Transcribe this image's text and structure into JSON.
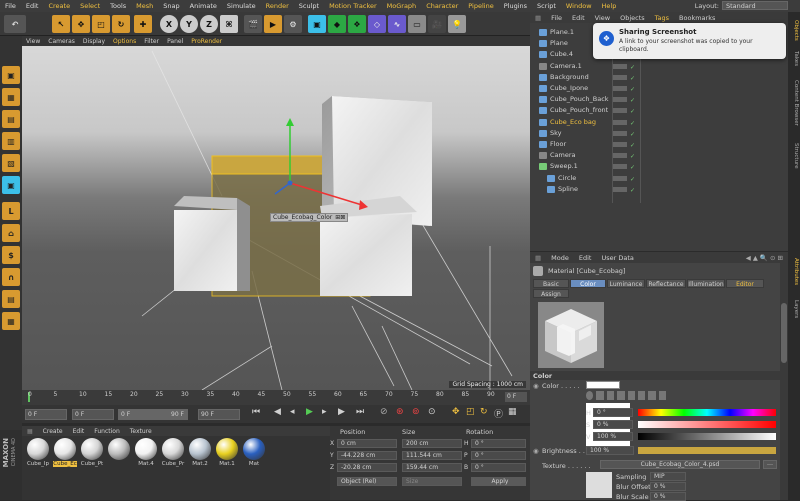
{
  "menubar": {
    "items": [
      "File",
      "Edit",
      "Create",
      "Select",
      "Tools",
      "Mesh",
      "Snap",
      "Animate",
      "Simulate",
      "Render",
      "Sculpt",
      "Motion Tracker",
      "MoGraph",
      "Character",
      "Pipeline",
      "Plugins",
      "Script",
      "Window",
      "Help"
    ],
    "highlighted": [
      "Create",
      "Select",
      "Mesh",
      "Render",
      "Motion Tracker",
      "MoGraph",
      "Character",
      "Pipeline",
      "Window",
      "Help"
    ],
    "layout_label": "Layout:",
    "layout_value": "Standard"
  },
  "toolbar": {
    "axis_x": "X",
    "axis_y": "Y",
    "axis_z": "Z"
  },
  "viewport": {
    "menu": [
      "View",
      "Cameras",
      "Display",
      "Options",
      "Filter",
      "Panel",
      "ProRender"
    ],
    "menu_highlight": [
      "Options",
      "ProRender"
    ],
    "perspective_label": "",
    "selected_object_label": "Cube_Ecobag_Color",
    "grid_spacing": "Grid Spacing : 1000 cm"
  },
  "timeline": {
    "ticks": [
      "0",
      "5",
      "10",
      "15",
      "20",
      "25",
      "30",
      "35",
      "40",
      "45",
      "50",
      "55",
      "60",
      "65",
      "70",
      "75",
      "80",
      "85",
      "90"
    ],
    "end_frame": "0 F",
    "current": "0 F",
    "start": "0 F",
    "min": "0 F",
    "max": "90 F",
    "max2": "90 F"
  },
  "material_panel": {
    "menu": [
      "Create",
      "Edit",
      "Function",
      "Texture"
    ],
    "materials": [
      {
        "label": "Cube_Ip",
        "color": "#d8d8d8"
      },
      {
        "label": "Cube_Ec",
        "color": "#e6e6e6",
        "selected": true
      },
      {
        "label": "Cube_Pt",
        "color": "#d4d4d4"
      },
      {
        "label": "",
        "color": "#bdbdbd"
      },
      {
        "label": "Mat.4",
        "color": "#f2f2f2"
      },
      {
        "label": "Cube_Pr",
        "color": "#d8d8d8"
      },
      {
        "label": "Mat.2",
        "color": "#b8c4d0"
      },
      {
        "label": "Mat.1",
        "color": "#e8d020"
      },
      {
        "label": "Mat",
        "color": "#2a60c0"
      }
    ]
  },
  "coords": {
    "headers": [
      "Position",
      "Size",
      "Rotation"
    ],
    "rows": [
      {
        "axis": "X",
        "pos": "0 cm",
        "size": "200 cm",
        "rot_label": "H",
        "rot": "0 °"
      },
      {
        "axis": "Y",
        "pos": "-44.228 cm",
        "size": "111.544 cm",
        "rot_label": "P",
        "rot": "0 °"
      },
      {
        "axis": "Z",
        "pos": "-20.28 cm",
        "size": "159.44 cm",
        "rot_label": "B",
        "rot": "0 °"
      }
    ],
    "mode": "Object (Rel)",
    "size_mode": "Size",
    "apply": "Apply"
  },
  "objects": {
    "menu": [
      "File",
      "Edit",
      "View",
      "Objects",
      "Tags",
      "Bookmarks"
    ],
    "menu_highlight": [
      "Tags"
    ],
    "rows": [
      {
        "name": "Plane.1",
        "icon": "#6aa0d8",
        "indent": 0
      },
      {
        "name": "Plane",
        "icon": "#6aa0d8",
        "indent": 0
      },
      {
        "name": "Cube.4",
        "icon": "#6aa0d8",
        "indent": 0
      },
      {
        "name": "Camera.1",
        "icon": "#888",
        "indent": 0
      },
      {
        "name": "Background",
        "icon": "#6aa0d8",
        "indent": 0
      },
      {
        "name": "Cube_Ipone",
        "icon": "#6aa0d8",
        "indent": 0
      },
      {
        "name": "Cube_Pouch_Back",
        "icon": "#6aa0d8",
        "indent": 0
      },
      {
        "name": "Cube_Pouch_front",
        "icon": "#6aa0d8",
        "indent": 0
      },
      {
        "name": "Cube_Eco bag",
        "icon": "#6aa0d8",
        "indent": 0,
        "selected": true
      },
      {
        "name": "Sky",
        "icon": "#6aa0d8",
        "indent": 0
      },
      {
        "name": "Floor",
        "icon": "#6aa0d8",
        "indent": 0
      },
      {
        "name": "Camera",
        "icon": "#888",
        "indent": 0
      },
      {
        "name": "Sweep.1",
        "icon": "#7c7",
        "indent": 0
      },
      {
        "name": "Circle",
        "icon": "#6aa0d8",
        "indent": 1
      },
      {
        "name": "Spline",
        "icon": "#6aa0d8",
        "indent": 1
      }
    ]
  },
  "toast": {
    "title": "Sharing Screenshot",
    "body": "A link to your screenshot was copied to your clipboard."
  },
  "attributes": {
    "menu": [
      "Mode",
      "Edit",
      "User Data"
    ],
    "title": "Material [Cube_Ecobag]",
    "tabs": [
      "Basic",
      "Color",
      "Luminance",
      "Reflectance",
      "Illumination",
      "Editor",
      "Assign"
    ],
    "active_tab": "Color",
    "section": "Color",
    "color_label": "Color . . . . .",
    "h_label": "H",
    "h_value": "0 °",
    "s_label": "S",
    "s_value": "0 %",
    "v_label": "V",
    "v_value": "100 %",
    "brightness_label": "Brightness . . .",
    "brightness_value": "100 %",
    "texture_label": "Texture . . . . . .",
    "texture_file": "Cube_Ecobag_Color_4.psd",
    "sampling_label": "Sampling",
    "sampling_value": "MIP",
    "blur_offset_label": "Blur Offset",
    "blur_offset_value": "0 %",
    "blur_scale_label": "Blur Scale",
    "blur_scale_value": "0 %"
  },
  "side_tabs": [
    "Objects",
    "Takes",
    "Content Browser",
    "Structure",
    "Attributes",
    "Layers"
  ],
  "brand": [
    "MAXON",
    "CINEMA 4D"
  ]
}
